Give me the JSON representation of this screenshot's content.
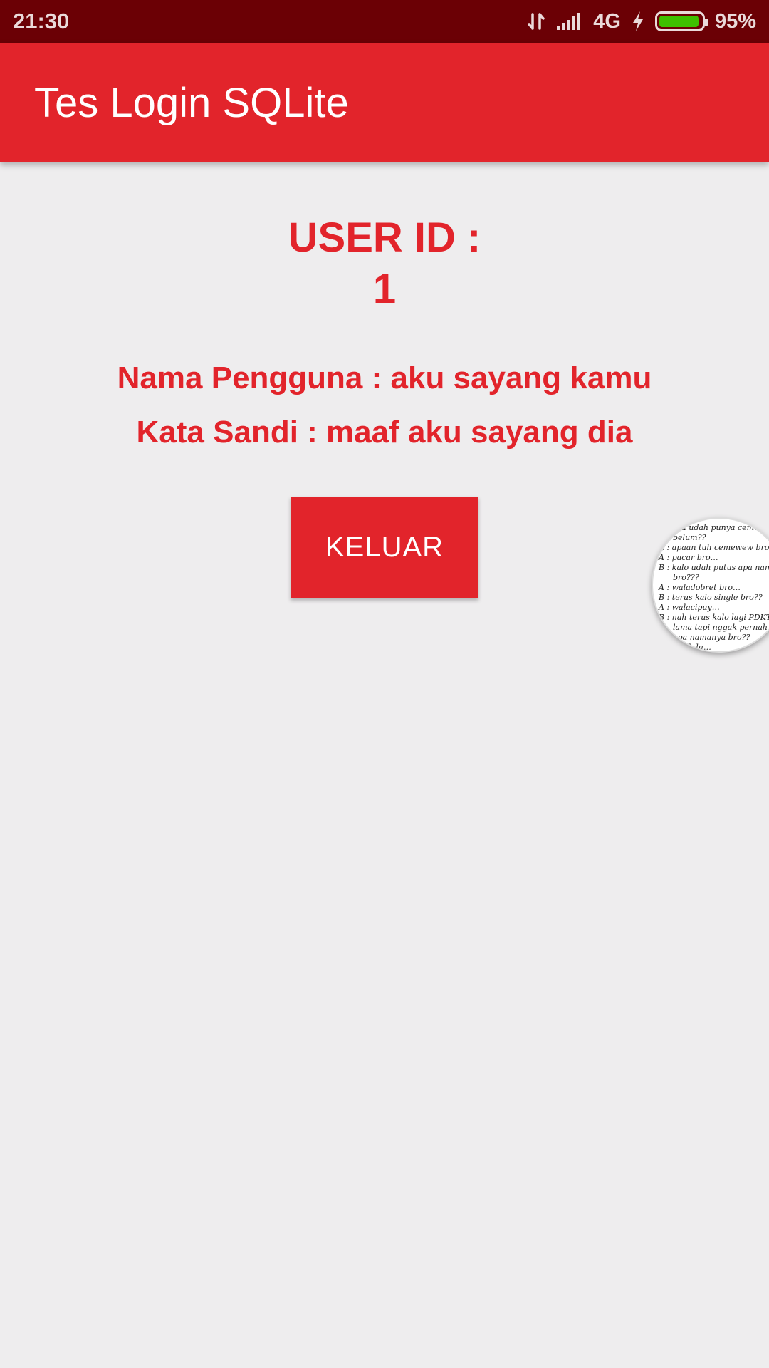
{
  "status_bar": {
    "time": "21:30",
    "network": "4G",
    "battery_percent": "95%",
    "battery_level": 0.95,
    "icons": [
      "data-transfer-icon",
      "signal-icon",
      "charging-icon",
      "battery-icon"
    ],
    "colors": {
      "background": "#6b0005",
      "battery_fill": "#3fbf00"
    }
  },
  "app_bar": {
    "title": "Tes Login SQLite",
    "color": "#e2242b"
  },
  "profile": {
    "user_id_label": "USER ID :",
    "user_id_value": "1",
    "username_line": "Nama Pengguna : aku sayang kamu",
    "password_line": "Kata Sandi : maaf aku sayang dia",
    "accent_color": "#e2242b"
  },
  "actions": {
    "logout_label": "KELUAR"
  },
  "floating_bubble": {
    "lines": [
      "…ah lu udah punya cem…",
      "belum??",
      "A : apaan tuh cemewew bro??",
      "A : pacar bro…",
      "B : kalo udah putus apa namnya",
      "bro???",
      "A : waladobret bro…",
      "B : terus kalo single bro??",
      "A : walacipuy…",
      "B : nah terus kalo lagi PDKT ud…",
      "lama tapi nggak pernah jad…",
      "apa namanya bro??",
      "…an deh lu…"
    ]
  }
}
